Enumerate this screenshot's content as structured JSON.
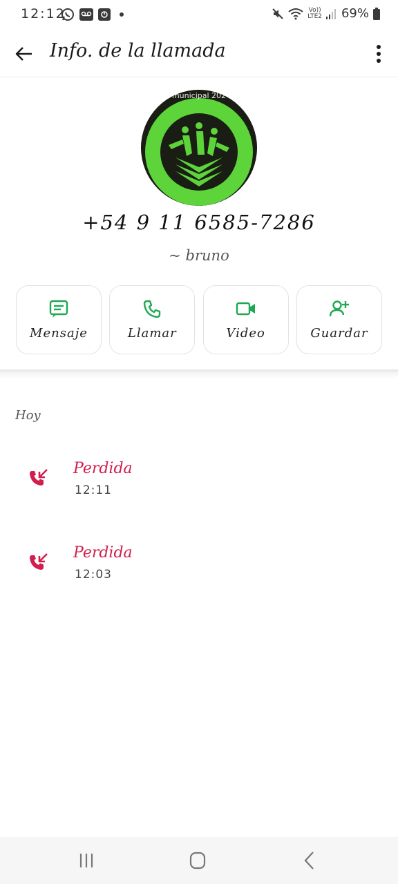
{
  "status_bar": {
    "time": "12:12",
    "battery": "69%",
    "lte_top": "Vo))",
    "lte_bottom": "LTE2",
    "icons": [
      "whatsapp-icon",
      "voicemail-icon",
      "recorder-icon",
      "notification-dot",
      "mute-icon",
      "wifi-icon",
      "signal-icon",
      "battery-icon"
    ]
  },
  "header": {
    "title": "Info. de la llamada",
    "back_icon": "arrow-left-icon",
    "menu_icon": "more-vertical-icon"
  },
  "contact": {
    "avatar_caption": "municipal 202",
    "phone": "+54 9 11 6585-7286",
    "alias": "~ bruno"
  },
  "actions": [
    {
      "label": "Mensaje",
      "icon": "message-icon"
    },
    {
      "label": "Llamar",
      "icon": "phone-icon"
    },
    {
      "label": "Video",
      "icon": "video-icon"
    },
    {
      "label": "Guardar",
      "icon": "add-contact-icon"
    }
  ],
  "history": {
    "section": "Hoy",
    "calls": [
      {
        "status": "Perdida",
        "time": "12:11",
        "icon": "missed-call-icon"
      },
      {
        "status": "Perdida",
        "time": "12:03",
        "icon": "missed-call-icon"
      }
    ]
  },
  "colors": {
    "accent_green": "#1da851",
    "missed_red": "#d11e4c",
    "avatar_green": "#5cd43a"
  },
  "nav": {
    "recents_icon": "recents-icon",
    "home_icon": "home-icon",
    "back_icon": "nav-back-icon"
  }
}
